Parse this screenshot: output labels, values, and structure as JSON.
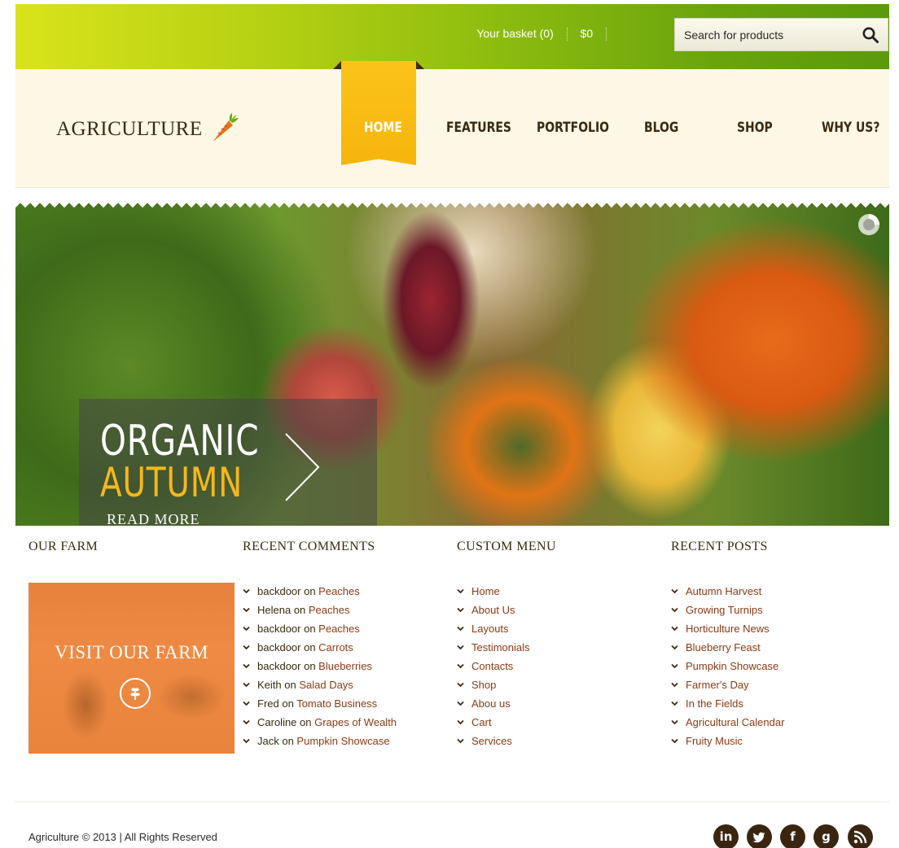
{
  "topbar": {
    "basket_label": "Your basket (0)",
    "basket_total": "$0",
    "search_placeholder": "Search for products"
  },
  "logo": {
    "text": "AGRICULTURE"
  },
  "nav": {
    "items": [
      {
        "label": "HOME"
      },
      {
        "label": "FEATURES"
      },
      {
        "label": "PORTFOLIO"
      },
      {
        "label": "BLOG"
      },
      {
        "label": "SHOP"
      },
      {
        "label": "WHY US?"
      }
    ]
  },
  "hero": {
    "line1": "ORGANIC",
    "line2": "AUTUMN",
    "read_more": "READ MORE"
  },
  "widgets": {
    "our_farm": {
      "title": "OUR FARM",
      "box_label": "VISIT OUR FARM"
    },
    "recent_comments": {
      "title": "RECENT COMMENTS",
      "items": [
        {
          "author": "backdoor",
          "on": " on ",
          "post": "Peaches"
        },
        {
          "author": "Helena",
          "on": " on ",
          "post": "Peaches"
        },
        {
          "author": "backdoor",
          "on": " on ",
          "post": "Peaches"
        },
        {
          "author": "backdoor",
          "on": " on ",
          "post": "Carrots"
        },
        {
          "author": "backdoor",
          "on": " on ",
          "post": "Blueberries"
        },
        {
          "author": "Keith",
          "on": " on ",
          "post": "Salad Days"
        },
        {
          "author": "Fred",
          "on": " on ",
          "post": "Tomato Business"
        },
        {
          "author": "Caroline",
          "on": " on ",
          "post": "Grapes of Wealth"
        },
        {
          "author": "Jack",
          "on": " on ",
          "post": "Pumpkin Showcase"
        }
      ]
    },
    "custom_menu": {
      "title": "CUSTOM MENU",
      "items": [
        "Home",
        "About Us",
        "Layouts",
        "Testimonials",
        "Contacts",
        "Shop",
        "Abou us",
        "Cart",
        "Services"
      ]
    },
    "recent_posts": {
      "title": "RECENT POSTS",
      "items": [
        "Autumn Harvest",
        "Growing Turnips",
        "Horticulture News",
        "Blueberry Feast",
        "Pumpkin Showcase",
        "Farmer's Day",
        "In the Fields",
        "Agricultural Calendar",
        "Fruity Music"
      ]
    }
  },
  "footer": {
    "copyright": "Agriculture © 2013 | All Rights Reserved",
    "social": [
      {
        "icon": "linkedin-icon",
        "glyph": "in"
      },
      {
        "icon": "twitter-icon",
        "glyph": "t"
      },
      {
        "icon": "facebook-icon",
        "glyph": "f"
      },
      {
        "icon": "google-plus-icon",
        "glyph": "g"
      },
      {
        "icon": "rss-icon",
        "glyph": ""
      }
    ]
  },
  "colors": {
    "accent_yellow": "#f6b50d",
    "brand_brown": "#3a2a10",
    "link_brown": "#8b3a14",
    "farm_orange": "#ee8a43",
    "topbar_green": "#8dbc0f"
  }
}
